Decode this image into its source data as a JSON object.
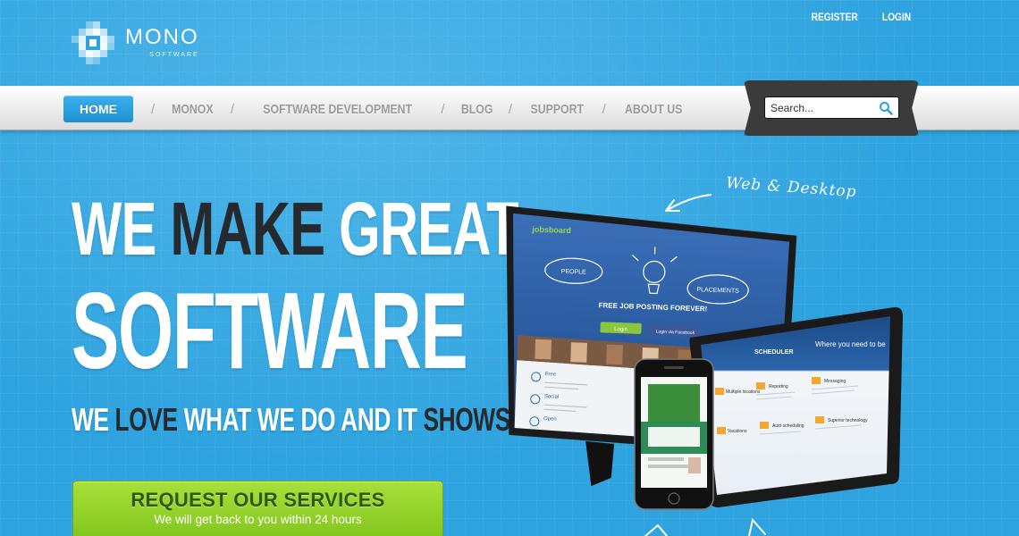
{
  "top_links": {
    "register": "REGISTER",
    "login": "LOGIN"
  },
  "logo": {
    "name": "MONO",
    "subtitle": "SOFTWARE"
  },
  "nav": {
    "items": [
      "HOME",
      "MONOX",
      "SOFTWARE DEVELOPMENT",
      "BLOG",
      "SUPPORT",
      "ABOUT US"
    ],
    "separator": "/",
    "active": "HOME"
  },
  "search": {
    "placeholder": "Search..."
  },
  "hero": {
    "line1": {
      "a": "WE ",
      "b": "MAKE",
      "c": " GREAT"
    },
    "line2": "SOFTWARE",
    "line3": {
      "a": "WE ",
      "b": "LOVE",
      "c": " WHAT WE DO AND IT ",
      "d": "SHOWS"
    }
  },
  "cta": {
    "title": "REQUEST OUR SERVICES",
    "subtitle": "We will get back to you within 24 hours"
  },
  "illustration": {
    "handwritten_label": "Web & Desktop",
    "monitor": {
      "brand": "jobsboard",
      "headline": "FREE JOB POSTING FOREVER!",
      "bubble_left": "PEOPLE",
      "bubble_right": "PLACEMENTS",
      "login_button": "Login",
      "facebook_button": "Login via Facebook",
      "features": [
        "Free",
        "Social",
        "Open"
      ]
    },
    "tablet": {
      "brand": "SCHEDULER",
      "headline": "Where you need to be",
      "features": [
        "Reporting",
        "Messaging",
        "Multiple locations",
        "Vacations",
        "Auto scheduling",
        "Superior technology"
      ]
    }
  },
  "colors": {
    "background": "#2ea3df",
    "nav_active": "#2b9fe0",
    "cta_green": "#8fd12a",
    "dark_text": "#26292d"
  }
}
